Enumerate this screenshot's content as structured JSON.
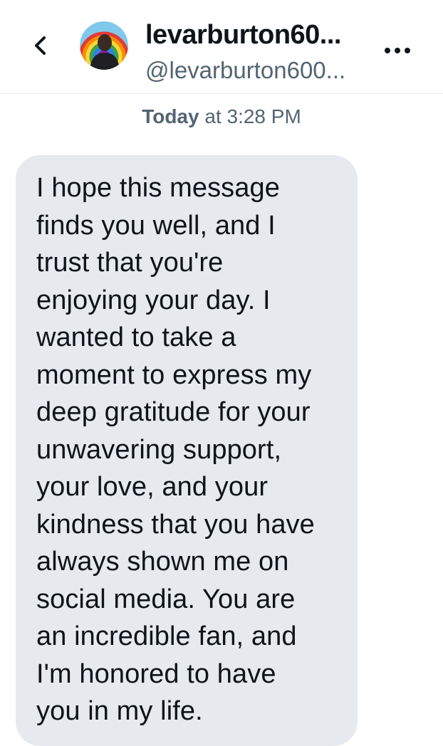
{
  "header": {
    "back_icon": "chevron-left-icon",
    "display_name": "levarburton60...",
    "handle": "@levarburton600...",
    "more_icon": "more-horizontal-icon",
    "avatar_icon": "profile-avatar"
  },
  "conversation": {
    "timestamp_day": "Today",
    "timestamp_rest": " at 3:28 PM",
    "message_lines": [
      "I hope this message",
      "finds you well, and I",
      "trust that you're",
      "enjoying your day. I",
      "wanted to take a",
      "moment to express my",
      "deep gratitude for your",
      "unwavering support,",
      "your love, and your",
      "kindness that you have",
      "always shown me on",
      "social media. You are",
      "an incredible fan, and",
      "I'm honored to have",
      "you in my life."
    ]
  },
  "colors": {
    "bubble_bg": "#e6e9ed",
    "secondary_text": "#536471",
    "primary_text": "#0f1419"
  }
}
